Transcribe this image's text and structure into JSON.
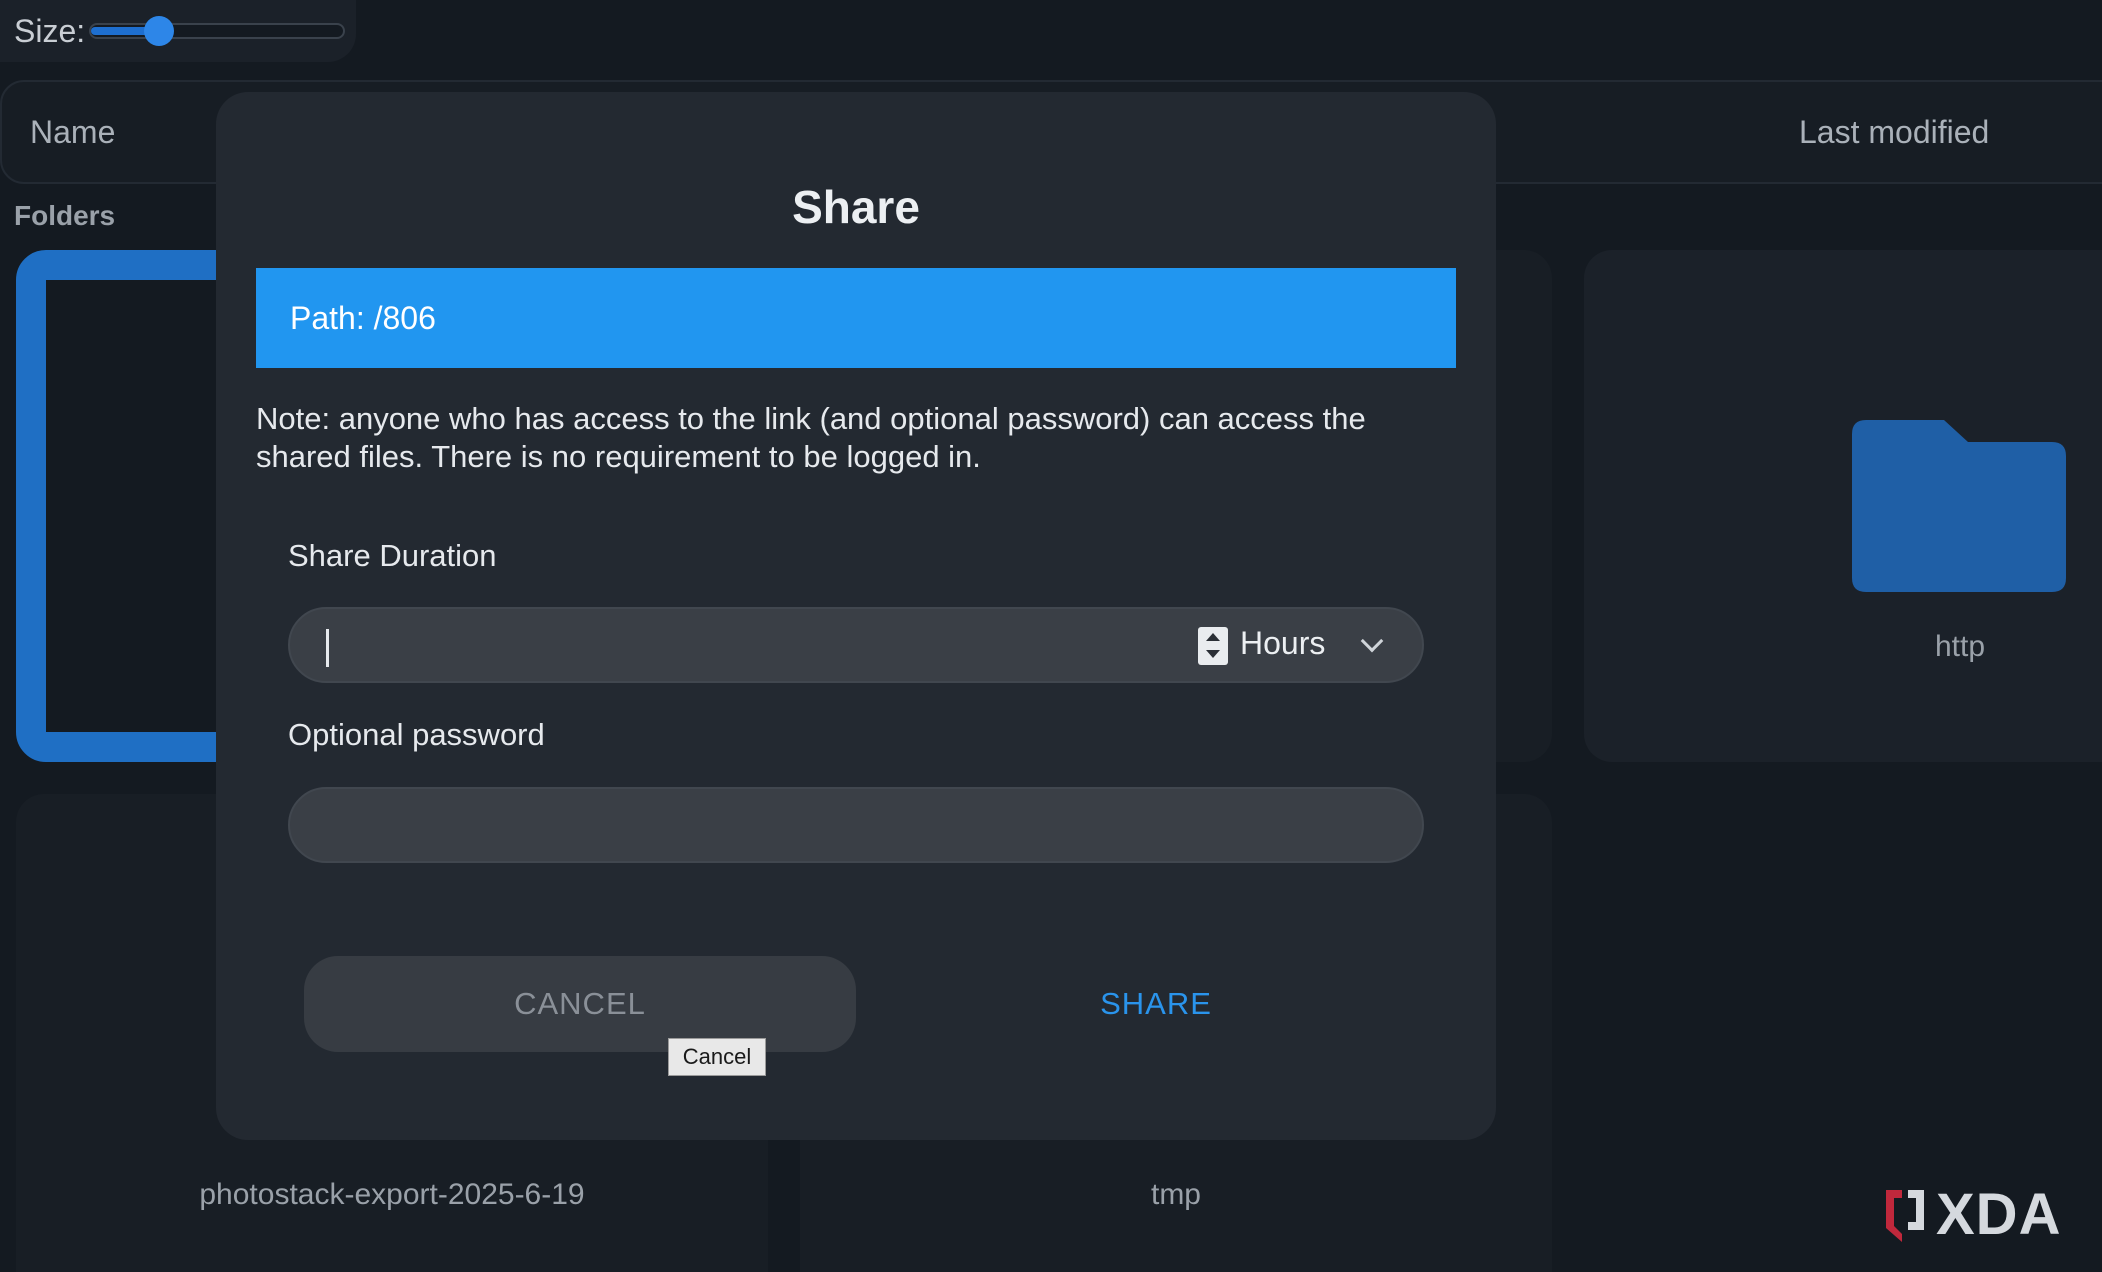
{
  "toolbar": {
    "size_label": "Size:",
    "size_slider_value": 0.27
  },
  "listing_header": {
    "name": "Name",
    "last_modified": "Last modified"
  },
  "folders": {
    "section_label": "Folders",
    "items": [
      {
        "name": ""
      },
      {
        "name": ""
      },
      {
        "name": "http"
      },
      {
        "name": "photostack-export-2025-6-19"
      },
      {
        "name": "tmp"
      }
    ]
  },
  "modal": {
    "title": "Share",
    "path": "Path: /806",
    "note": "Note: anyone who has access to the link (and optional password) can access the shared files. There is no requirement to be logged in.",
    "duration_label": "Share Duration",
    "duration_value": "",
    "duration_unit": "Hours",
    "password_label": "Optional password",
    "password_value": "",
    "cancel_label": "CANCEL",
    "share_label": "SHARE",
    "cancel_tooltip": "Cancel"
  },
  "watermark": {
    "text": "XDA"
  },
  "colors": {
    "accent": "#2196f0",
    "folder": "#1f6fc4",
    "share_text": "#2a94ec",
    "background": "#141a21",
    "modal_bg": "#232931"
  },
  "icons": {
    "folder": "folder-icon",
    "spinner": "stepper-icon",
    "dropdown": "chevron-down-icon"
  }
}
